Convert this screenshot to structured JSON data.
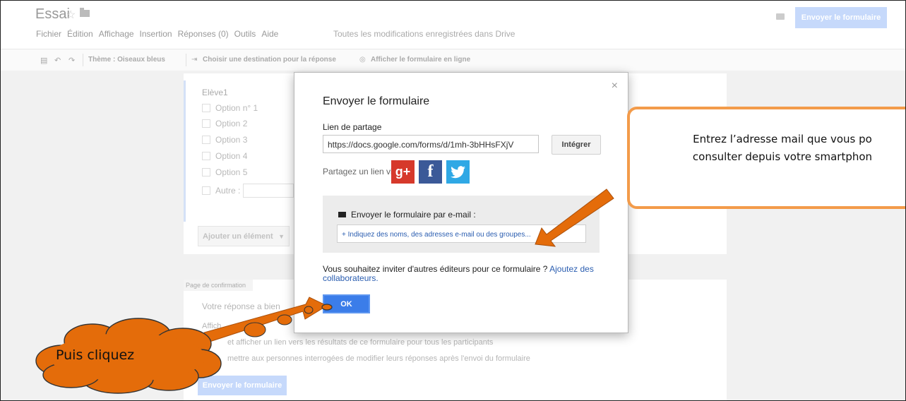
{
  "header": {
    "title": "Essai",
    "menu": [
      "Fichier",
      "Édition",
      "Affichage",
      "Insertion",
      "Réponses (0)",
      "Outils",
      "Aide"
    ],
    "save_status": "Toutes les modifications enregistrées dans Drive",
    "send_button": "Envoyer le formulaire"
  },
  "toolbar": {
    "theme": "Thème : Oiseaux bleus",
    "destination": "Choisir une destination pour la réponse",
    "view_online": "Afficher le formulaire en ligne"
  },
  "question": {
    "title": "Elève1",
    "options": [
      "Option n° 1",
      "Option 2",
      "Option 3",
      "Option 4",
      "Option 5"
    ],
    "other": "Autre :",
    "add_element": "Ajouter un élément"
  },
  "confirmation": {
    "tab": "Page de confirmation",
    "message": "Votre réponse a bien",
    "line1": "Affich",
    "line2": "et afficher un lien vers les résultats de ce formulaire pour tous les participants",
    "line3": "mettre aux personnes interrogées de modifier leurs réponses après l'envoi du formulaire",
    "send_button": "Envoyer le formulaire"
  },
  "modal": {
    "title": "Envoyer le formulaire",
    "close": "×",
    "share_label": "Lien de partage",
    "share_link": "https://docs.google.com/forms/d/1mh-3bHHsFXjV",
    "integrate_button": "Intégrer",
    "share_via": "Partagez un lien via :",
    "social": [
      "g+",
      "f",
      "t"
    ],
    "email_label": "Envoyer le formulaire par e-mail :",
    "email_placeholder": "+ Indiquez des noms, des adresses e-mail ou des groupes...",
    "invite_text": "Vous souhaitez inviter d'autres éditeurs pour ce formulaire ?",
    "invite_link": "Ajoutez des collaborateurs.",
    "ok_button": "OK"
  },
  "annotations": {
    "callout": "Entrez l’adresse mail que vous po\nconsulter depuis votre smartphon",
    "cloud": "Puis  cliquez",
    "callout_border": "#f39b4a",
    "arrow_fill": "#e46c0a",
    "cloud_fill": "#e46c0a"
  }
}
